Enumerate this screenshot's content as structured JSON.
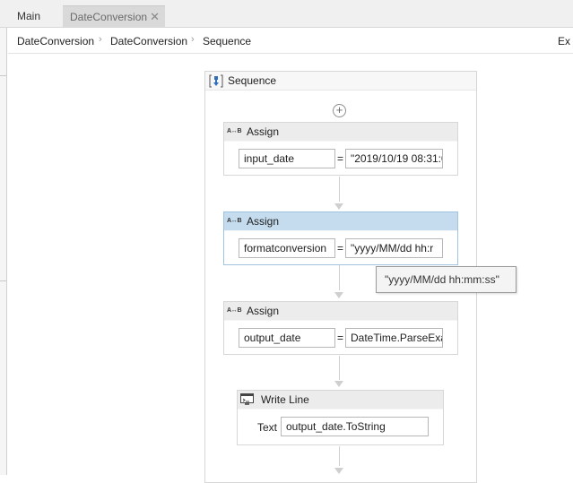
{
  "tabs": {
    "main_label": "Main",
    "active_label": "DateConversion",
    "close_glyph": "✕"
  },
  "breadcrumb": {
    "items": [
      "DateConversion",
      "DateConversion",
      "Sequence"
    ],
    "separator": "›",
    "right_label": "Ex"
  },
  "sequence": {
    "title": "Sequence",
    "add_glyph": "+"
  },
  "activities": [
    {
      "title": "Assign",
      "icon_text": "A↔B",
      "to": "input_date",
      "operator": "=",
      "value": "\"2019/10/19 08:31:0"
    },
    {
      "title": "Assign",
      "icon_text": "A↔B",
      "to": "formatconversion",
      "operator": "=",
      "value": "\"yyyy/MM/dd hh:r"
    },
    {
      "title": "Assign",
      "icon_text": "A↔B",
      "to": "output_date",
      "operator": "=",
      "value": "DateTime.ParseExa"
    }
  ],
  "tooltip": {
    "text": "\"yyyy/MM/dd hh:mm:ss\""
  },
  "write_line": {
    "title": "Write Line",
    "text_label": "Text",
    "text_value": "output_date.ToString"
  },
  "colors": {
    "selected_header": "#c5dcef",
    "connector": "#cfcfcf",
    "sequence_icon": "#2f6fba"
  }
}
